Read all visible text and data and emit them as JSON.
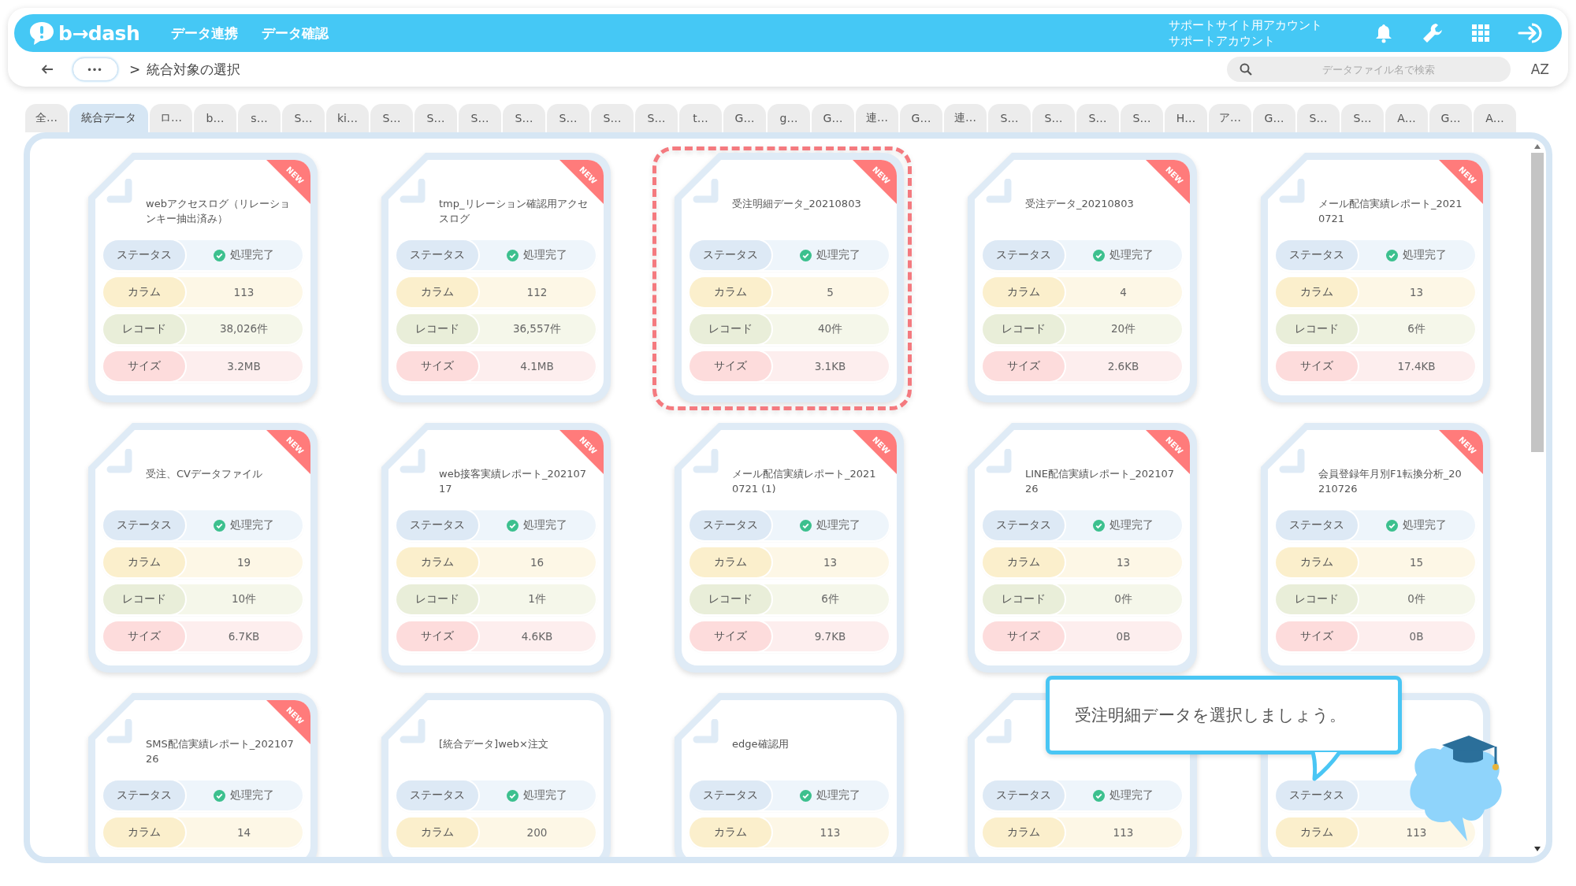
{
  "header": {
    "logo": "b→dash",
    "nav": [
      {
        "label": "データ連携"
      },
      {
        "label": "データ確認"
      }
    ],
    "account_lines": [
      "サポートサイト用アカウント",
      "サポートアカウント"
    ]
  },
  "breadcrumb": {
    "more": "•••",
    "separator": ">",
    "current": "統合対象の選択"
  },
  "search": {
    "placeholder": "データファイル名で検索"
  },
  "sort_label": "AZ",
  "tabs": [
    {
      "label": "全…",
      "selected": false
    },
    {
      "label": "統合データ",
      "selected": true
    },
    {
      "label": "ロ…",
      "selected": false
    },
    {
      "label": "b…",
      "selected": false
    },
    {
      "label": "s…",
      "selected": false
    },
    {
      "label": "S…",
      "selected": false
    },
    {
      "label": "ki…",
      "selected": false
    },
    {
      "label": "S…",
      "selected": false
    },
    {
      "label": "S…",
      "selected": false
    },
    {
      "label": "S…",
      "selected": false
    },
    {
      "label": "S…",
      "selected": false
    },
    {
      "label": "S…",
      "selected": false
    },
    {
      "label": "S…",
      "selected": false
    },
    {
      "label": "S…",
      "selected": false
    },
    {
      "label": "t…",
      "selected": false
    },
    {
      "label": "G…",
      "selected": false
    },
    {
      "label": "g…",
      "selected": false
    },
    {
      "label": "G…",
      "selected": false
    },
    {
      "label": "連…",
      "selected": false
    },
    {
      "label": "G…",
      "selected": false
    },
    {
      "label": "連…",
      "selected": false
    },
    {
      "label": "S…",
      "selected": false
    },
    {
      "label": "S…",
      "selected": false
    },
    {
      "label": "S…",
      "selected": false
    },
    {
      "label": "S…",
      "selected": false
    },
    {
      "label": "H…",
      "selected": false
    },
    {
      "label": "ア…",
      "selected": false
    },
    {
      "label": "G…",
      "selected": false
    },
    {
      "label": "S…",
      "selected": false
    },
    {
      "label": "S…",
      "selected": false
    },
    {
      "label": "A…",
      "selected": false
    },
    {
      "label": "G…",
      "selected": false
    },
    {
      "label": "A…",
      "selected": false
    }
  ],
  "cards": [
    {
      "title": "webアクセスログ（リレーションキー抽出済み）",
      "badge": "NEW",
      "selected": false,
      "stats": [
        {
          "kind": "status",
          "label": "ステータス",
          "value": "処理完了"
        },
        {
          "kind": "column",
          "label": "カラム",
          "value": "113"
        },
        {
          "kind": "record",
          "label": "レコード",
          "value": "38,026件"
        },
        {
          "kind": "size",
          "label": "サイズ",
          "value": "3.2MB"
        }
      ]
    },
    {
      "title": "tmp_リレーション確認用アクセスログ",
      "badge": "NEW",
      "selected": false,
      "stats": [
        {
          "kind": "status",
          "label": "ステータス",
          "value": "処理完了"
        },
        {
          "kind": "column",
          "label": "カラム",
          "value": "112"
        },
        {
          "kind": "record",
          "label": "レコード",
          "value": "36,557件"
        },
        {
          "kind": "size",
          "label": "サイズ",
          "value": "4.1MB"
        }
      ]
    },
    {
      "title": "受注明細データ_20210803",
      "badge": "NEW",
      "selected": true,
      "stats": [
        {
          "kind": "status",
          "label": "ステータス",
          "value": "処理完了"
        },
        {
          "kind": "column",
          "label": "カラム",
          "value": "5"
        },
        {
          "kind": "record",
          "label": "レコード",
          "value": "40件"
        },
        {
          "kind": "size",
          "label": "サイズ",
          "value": "3.1KB"
        }
      ]
    },
    {
      "title": "受注データ_20210803",
      "badge": "NEW",
      "selected": false,
      "stats": [
        {
          "kind": "status",
          "label": "ステータス",
          "value": "処理完了"
        },
        {
          "kind": "column",
          "label": "カラム",
          "value": "4"
        },
        {
          "kind": "record",
          "label": "レコード",
          "value": "20件"
        },
        {
          "kind": "size",
          "label": "サイズ",
          "value": "2.6KB"
        }
      ]
    },
    {
      "title": "メール配信実績レポート_20210721",
      "badge": "NEW",
      "selected": false,
      "stats": [
        {
          "kind": "status",
          "label": "ステータス",
          "value": "処理完了"
        },
        {
          "kind": "column",
          "label": "カラム",
          "value": "13"
        },
        {
          "kind": "record",
          "label": "レコード",
          "value": "6件"
        },
        {
          "kind": "size",
          "label": "サイズ",
          "value": "17.4KB"
        }
      ]
    },
    {
      "title": "受注、CVデータファイル",
      "badge": "NEW",
      "selected": false,
      "stats": [
        {
          "kind": "status",
          "label": "ステータス",
          "value": "処理完了"
        },
        {
          "kind": "column",
          "label": "カラム",
          "value": "19"
        },
        {
          "kind": "record",
          "label": "レコード",
          "value": "10件"
        },
        {
          "kind": "size",
          "label": "サイズ",
          "value": "6.7KB"
        }
      ]
    },
    {
      "title": "web接客実績レポート_20210717",
      "badge": "NEW",
      "selected": false,
      "stats": [
        {
          "kind": "status",
          "label": "ステータス",
          "value": "処理完了"
        },
        {
          "kind": "column",
          "label": "カラム",
          "value": "16"
        },
        {
          "kind": "record",
          "label": "レコード",
          "value": "1件"
        },
        {
          "kind": "size",
          "label": "サイズ",
          "value": "4.6KB"
        }
      ]
    },
    {
      "title": "メール配信実績レポート_20210721 (1)",
      "badge": "NEW",
      "selected": false,
      "stats": [
        {
          "kind": "status",
          "label": "ステータス",
          "value": "処理完了"
        },
        {
          "kind": "column",
          "label": "カラム",
          "value": "13"
        },
        {
          "kind": "record",
          "label": "レコード",
          "value": "6件"
        },
        {
          "kind": "size",
          "label": "サイズ",
          "value": "9.7KB"
        }
      ]
    },
    {
      "title": "LINE配信実績レポート_20210726",
      "badge": "NEW",
      "selected": false,
      "stats": [
        {
          "kind": "status",
          "label": "ステータス",
          "value": "処理完了"
        },
        {
          "kind": "column",
          "label": "カラム",
          "value": "13"
        },
        {
          "kind": "record",
          "label": "レコード",
          "value": "0件"
        },
        {
          "kind": "size",
          "label": "サイズ",
          "value": "0B"
        }
      ]
    },
    {
      "title": "会員登録年月別F1転換分析_20210726",
      "badge": "NEW",
      "selected": false,
      "stats": [
        {
          "kind": "status",
          "label": "ステータス",
          "value": "処理完了"
        },
        {
          "kind": "column",
          "label": "カラム",
          "value": "15"
        },
        {
          "kind": "record",
          "label": "レコード",
          "value": "0件"
        },
        {
          "kind": "size",
          "label": "サイズ",
          "value": "0B"
        }
      ]
    },
    {
      "title": "SMS配信実績レポート_20210726",
      "badge": "NEW",
      "selected": false,
      "stats": [
        {
          "kind": "status",
          "label": "ステータス",
          "value": "処理完了"
        },
        {
          "kind": "column",
          "label": "カラム",
          "value": "14"
        }
      ]
    },
    {
      "title": "[統合データ]web×注文",
      "selected": false,
      "stats": [
        {
          "kind": "status",
          "label": "ステータス",
          "value": "処理完了"
        },
        {
          "kind": "column",
          "label": "カラム",
          "value": "200"
        }
      ]
    },
    {
      "title": "edge確認用",
      "selected": false,
      "stats": [
        {
          "kind": "status",
          "label": "ステータス",
          "value": "処理完了"
        },
        {
          "kind": "column",
          "label": "カラム",
          "value": "113"
        }
      ]
    },
    {
      "selected": false,
      "stats": [
        {
          "kind": "status",
          "label": "ステータス",
          "value": "処理完了"
        },
        {
          "kind": "column",
          "label": "カラム",
          "value": "113"
        }
      ]
    },
    {
      "selected": false,
      "covered_by_tooltip": true,
      "stats": [
        {
          "kind": "status",
          "label": "ステータス"
        },
        {
          "kind": "column",
          "label": "カラム",
          "value": "113"
        }
      ]
    }
  ],
  "tooltip": {
    "text": "受注明細データを選択しましょう。"
  }
}
